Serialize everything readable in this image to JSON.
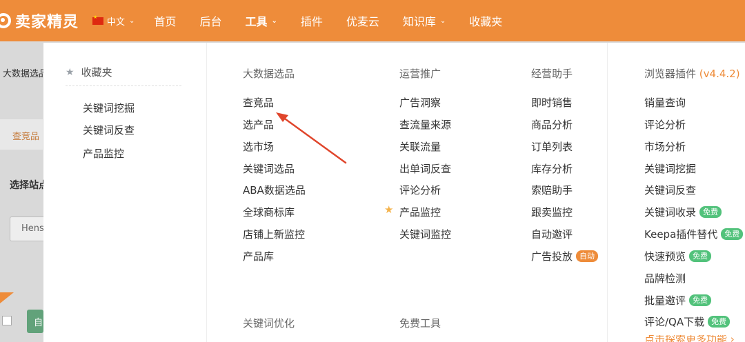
{
  "brand": {
    "name": "卖家精灵"
  },
  "lang": {
    "label": "中文"
  },
  "nav": {
    "items": [
      {
        "label": "首页"
      },
      {
        "label": "后台"
      },
      {
        "label": "工具"
      },
      {
        "label": "插件"
      },
      {
        "label": "优麦云"
      },
      {
        "label": "知识库"
      },
      {
        "label": "收藏夹"
      }
    ]
  },
  "background": {
    "crumb": "大数据选品",
    "tab": "查竞品",
    "site_label": "选择站点",
    "input_value": "Hens",
    "green_btn": "自"
  },
  "favorites": {
    "title": "收藏夹",
    "items": [
      "关键词挖掘",
      "关键词反查",
      "产品监控"
    ]
  },
  "sections": {
    "bigdata": {
      "title": "大数据选品",
      "items": [
        "查竞品",
        "选产品",
        "选市场",
        "关键词选品",
        "ABA数据选品",
        "全球商标库",
        "店铺上新监控",
        "产品库"
      ]
    },
    "ops": {
      "title": "运营推广",
      "items": [
        "广告洞察",
        "查流量来源",
        "关联流量",
        "出单词反查",
        "评论分析",
        "产品监控",
        "关键词监控"
      ]
    },
    "biz": {
      "title": "经营助手",
      "items": [
        "即时销售",
        "商品分析",
        "订单列表",
        "库存分析",
        "索赔助手",
        "跟卖监控",
        "自动邀评",
        "广告投放"
      ],
      "badge": "自动"
    },
    "plugin": {
      "title": "浏览器插件",
      "version": "(v4.4.2)",
      "items": [
        "销量查询",
        "评论分析",
        "市场分析",
        "关键词挖掘",
        "关键词反查",
        "关键词收录",
        "Keepa插件替代",
        "快速预览",
        "品牌检测",
        "批量邀评",
        "评论/QA下载"
      ],
      "free_badge": "免费",
      "more": "点击探索更多功能"
    },
    "kw_opt": {
      "title": "关键词优化"
    },
    "free_tools": {
      "title": "免费工具"
    }
  },
  "colors": {
    "brand_orange": "#ee8c3a",
    "free_green": "#52c27b"
  }
}
